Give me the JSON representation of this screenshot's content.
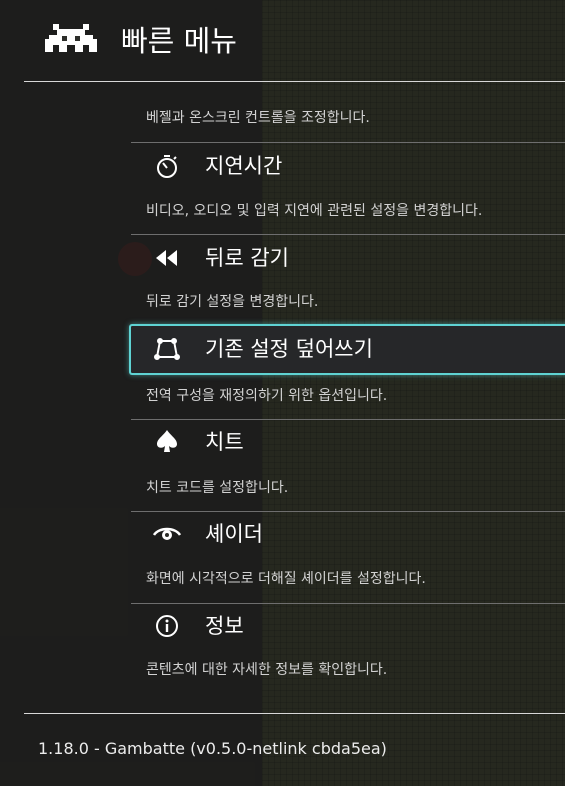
{
  "header": {
    "title": "빠른 메뉴",
    "logo_icon": "retroarch-invader-icon"
  },
  "menu": {
    "partial_item": {
      "sublabel": "베젤과 온스크린 컨트롤을 조정합니다."
    },
    "items": [
      {
        "label": "지연시간",
        "sublabel": "비디오, 오디오 및 입력 지연에 관련된 설정을 변경합니다.",
        "icon": "stopwatch-icon"
      },
      {
        "label": "뒤로 감기",
        "sublabel": "뒤로 감기 설정을 변경합니다.",
        "icon": "rewind-icon"
      },
      {
        "label": "기존 설정 덮어쓰기",
        "sublabel": "전역 구성을 재정의하기 위한 옵션입니다.",
        "icon": "overrides-icon",
        "selected": true
      },
      {
        "label": "치트",
        "sublabel": "치트 코드를 설정합니다.",
        "icon": "spade-icon"
      },
      {
        "label": "셰이더",
        "sublabel": "화면에 시각적으로 더해질 셰이더를 설정합니다.",
        "icon": "eye-icon"
      },
      {
        "label": "정보",
        "sublabel": "콘텐츠에 대한 자세한 정보를 확인합니다.",
        "icon": "info-icon"
      }
    ]
  },
  "footer": {
    "core_info": "1.18.0 - Gambatte (v0.5.0-netlink cbda5ea)"
  },
  "colors": {
    "accent": "#5fd3d3",
    "background": "#2b2c28",
    "selected_bg": "#262729"
  }
}
